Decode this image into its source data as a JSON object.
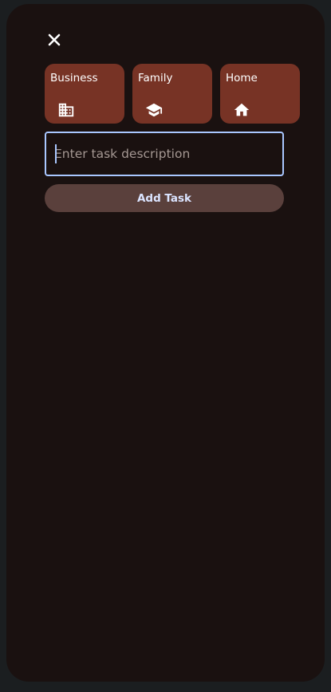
{
  "sheet": {
    "close_icon": "close-icon"
  },
  "categories": [
    {
      "label": "Business",
      "icon": "business-icon"
    },
    {
      "label": "Family",
      "icon": "school-icon"
    },
    {
      "label": "Home",
      "icon": "home-icon"
    }
  ],
  "task_input": {
    "placeholder": "Enter task description",
    "value": ""
  },
  "add_button": {
    "label": "Add Task"
  },
  "colors": {
    "background": "#1b1e20",
    "sheet": "#1a1110",
    "category_tile": "#773325",
    "input_border": "#a9c7ff",
    "button": "#5a403c",
    "button_text": "#dbe4ff"
  }
}
